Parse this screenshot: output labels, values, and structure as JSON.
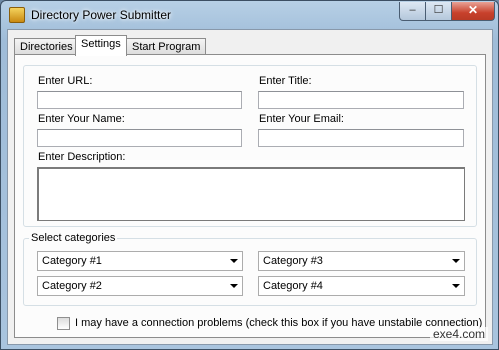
{
  "window": {
    "title": "Directory Power Submitter",
    "close_glyph": "✕",
    "min_glyph": "–",
    "max_glyph": "☐"
  },
  "tabs": [
    {
      "label": "Directories"
    },
    {
      "label": "Settings"
    },
    {
      "label": "Start Program"
    }
  ],
  "form": {
    "url_label": "Enter URL:",
    "url_value": "",
    "title_label": "Enter Title:",
    "title_value": "",
    "name_label": "Enter Your Name:",
    "name_value": "",
    "email_label": "Enter Your Email:",
    "email_value": "",
    "description_label": "Enter Description:",
    "description_value": ""
  },
  "categories": {
    "legend": "Select categories",
    "selects": [
      "Category #1",
      "Category #3",
      "Category #2",
      "Category #4"
    ]
  },
  "connection": {
    "label": "I may have a connection problems (check this box if you have unstabile connection)",
    "checked": false
  },
  "watermark": "exe4.com"
}
